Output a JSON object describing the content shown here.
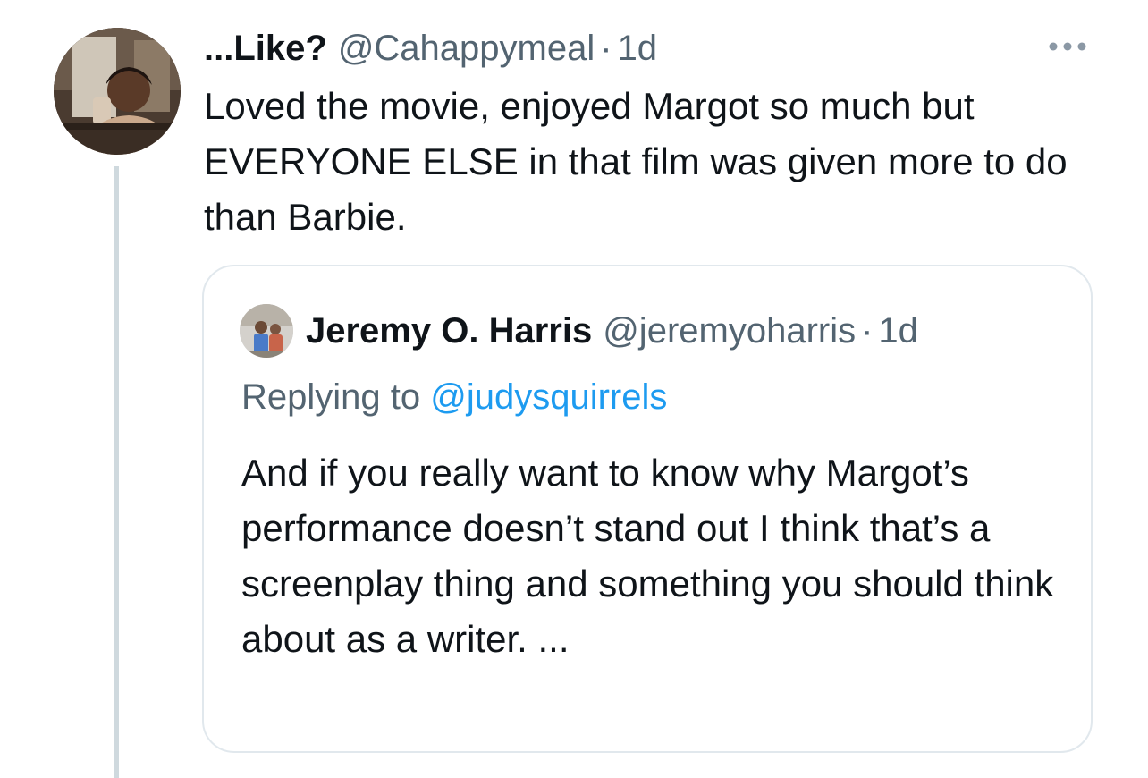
{
  "tweet": {
    "display_name": "...Like?",
    "handle": "@Cahappymeal",
    "separator": "·",
    "time": "1d",
    "text": "Loved the movie, enjoyed Margot so much but EVERYONE ELSE in that film was given more to do than Barbie.",
    "more_icon": "more-horizontal-icon"
  },
  "quote": {
    "display_name": "Jeremy O. Harris",
    "handle": "@jeremyoharris",
    "separator": "·",
    "time": "1d",
    "replying_prefix": "Replying to",
    "replying_handle": "@judysquirrels",
    "text": "And if you really want to know why Margot’s performance doesn’t stand out I think that’s a screenplay thing and something you should think about as a writer. ..."
  },
  "colors": {
    "text_primary": "#0f1419",
    "text_secondary": "#536471",
    "link": "#1d9bf0",
    "border": "#e1e8ed",
    "thread_line": "#cfd9de"
  }
}
